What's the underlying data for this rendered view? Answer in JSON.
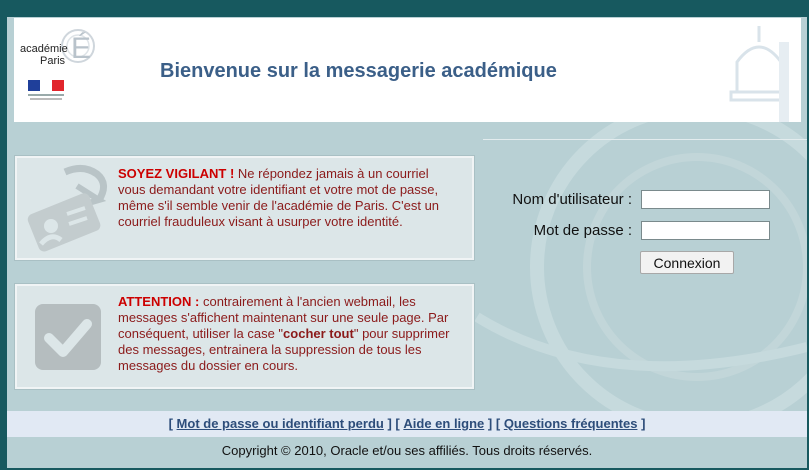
{
  "header": {
    "logo_line1": "académie",
    "logo_line2": "Paris",
    "logo_letter": "É",
    "title": "Bienvenue sur la messagerie académique"
  },
  "notices": [
    {
      "heading": "SOYEZ VIGILANT !",
      "body": " Ne répondez jamais à un courriel vous demandant votre identifiant et votre mot de passe, même s'il semble venir de l'académie de Paris. C'est un courriel frauduleux visant à usurper votre identité.",
      "icon": "id-card-hook-icon"
    },
    {
      "heading": "ATTENTION :",
      "body_before": " contrairement à l'ancien webmail, les messages s'affichent maintenant sur une seule page. Par conséquent, utiliser la case \"",
      "bold": "cocher tout",
      "body_after": "\" pour supprimer des messages, entrainera la suppression de tous les messages du dossier en cours.",
      "icon": "checkmark-icon"
    }
  ],
  "login": {
    "username_label": "Nom d'utilisateur :",
    "username_value": "",
    "password_label": "Mot de passe :",
    "password_value": "",
    "submit_label": "Connexion"
  },
  "footer": {
    "links": [
      "Mot de passe ou identifiant perdu",
      "Aide en ligne",
      "Questions fréquentes"
    ],
    "copyright": "Copyright © 2010, Oracle et/ou ses affiliés. Tous droits réservés."
  },
  "colors": {
    "background": "#17595f",
    "panel": "#b8d0d4",
    "title": "#3b5f88",
    "alert": "#cc0000",
    "notice_text": "#8b1a1a",
    "link": "#2d4d7a"
  }
}
